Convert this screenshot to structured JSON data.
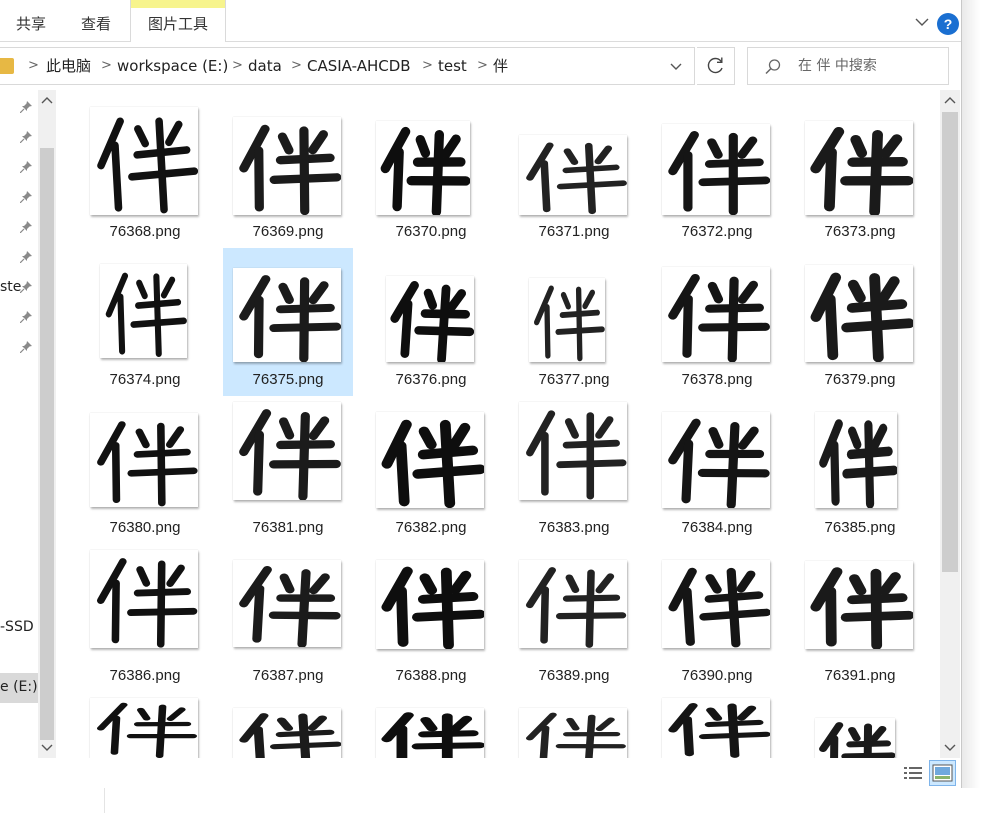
{
  "ribbon": {
    "tabs": [
      {
        "label": "共享"
      },
      {
        "label": "查看"
      },
      {
        "label": "图片工具"
      }
    ],
    "help_label": "?"
  },
  "address": {
    "separator": ">",
    "crumbs": [
      "此电脑",
      "workspace (E:)",
      "data",
      "CASIA-AHCDB",
      "test",
      "伴"
    ]
  },
  "search": {
    "placeholder": "在 伴 中搜索"
  },
  "nav": {
    "partial_items": [
      {
        "text": "ste"
      },
      {
        "text": "-SSD"
      },
      {
        "text": "e (E:)"
      }
    ]
  },
  "files": [
    {
      "name": "76368.png"
    },
    {
      "name": "76369.png"
    },
    {
      "name": "76370.png"
    },
    {
      "name": "76371.png"
    },
    {
      "name": "76372.png"
    },
    {
      "name": "76373.png"
    },
    {
      "name": "76374.png"
    },
    {
      "name": "76375.png",
      "selected": true
    },
    {
      "name": "76376.png"
    },
    {
      "name": "76377.png"
    },
    {
      "name": "76378.png"
    },
    {
      "name": "76379.png"
    },
    {
      "name": "76380.png"
    },
    {
      "name": "76381.png"
    },
    {
      "name": "76382.png"
    },
    {
      "name": "76383.png"
    },
    {
      "name": "76384.png"
    },
    {
      "name": "76385.png"
    },
    {
      "name": "76386.png"
    },
    {
      "name": "76387.png"
    },
    {
      "name": "76388.png"
    },
    {
      "name": "76389.png"
    },
    {
      "name": "76390.png"
    },
    {
      "name": "76391.png"
    },
    {
      "name": ""
    },
    {
      "name": ""
    },
    {
      "name": ""
    },
    {
      "name": ""
    },
    {
      "name": ""
    },
    {
      "name": ""
    }
  ],
  "colors": {
    "selection": "#cce8ff",
    "picture_tools_band": "#f7f48d",
    "help_blue": "#1a6fd1",
    "folder": "#e7b844"
  },
  "icons": {
    "view_details": "details-view-icon",
    "view_thumbnails": "large-icons-view-icon",
    "refresh": "refresh-icon",
    "search": "search-icon"
  }
}
